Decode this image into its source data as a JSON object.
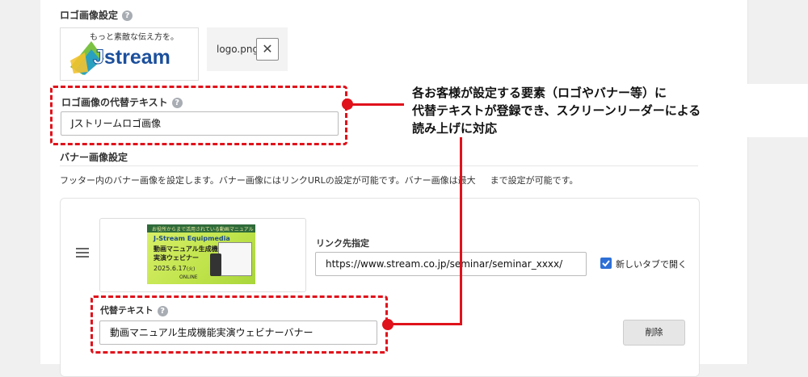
{
  "logo_section": {
    "label": "ロゴ画像設定",
    "logo_tagline": "もっと素敵な伝え方を。",
    "logo_wordmark_initial": "J",
    "logo_wordmark_rest": "stream",
    "file_name": "logo.png",
    "remove_symbol": "✕"
  },
  "alt_text_logo": {
    "label": "ロゴ画像の代替テキスト",
    "value": "Jストリームロゴ画像"
  },
  "banner_section": {
    "label": "バナー画像設定",
    "description": "フッター内のバナー画像を設定します。バナー画像にはリンクURLの設定が可能です。バナー画像は最大",
    "description_tail": "まで設定が可能です。",
    "banner_image": {
      "top_text": "お役所からまで活用されている動画マニュアル",
      "brand": "J-Stream Equipmedia",
      "headline1": "動画マニュアル生成機能",
      "headline2": "実演ウェビナー",
      "date": "2025.6.17",
      "weekday": "(火)",
      "mode": "ONLINE"
    },
    "link_label": "リンク先指定",
    "link_value": "https://www.stream.co.jp/seminar/seminar_xxxx/",
    "new_tab_label": "新しいタブで開く",
    "new_tab_checked": true,
    "alt_label": "代替テキスト",
    "alt_value": "動画マニュアル生成機能実演ウェビナーバナー",
    "delete_label": "削除"
  },
  "annotation": {
    "line1": "各お客様が設定する要素（ロゴやバナー等）に",
    "line2": "代替テキストが登録でき、スクリーンリーダーによる",
    "line3": "読み上げに対応"
  },
  "help_symbol": "?",
  "colors": {
    "annotation_red": "#e0121b",
    "checkbox_blue": "#2d6fd6",
    "logo_green": "#7bc242",
    "logo_blue": "#1b4f9c"
  }
}
